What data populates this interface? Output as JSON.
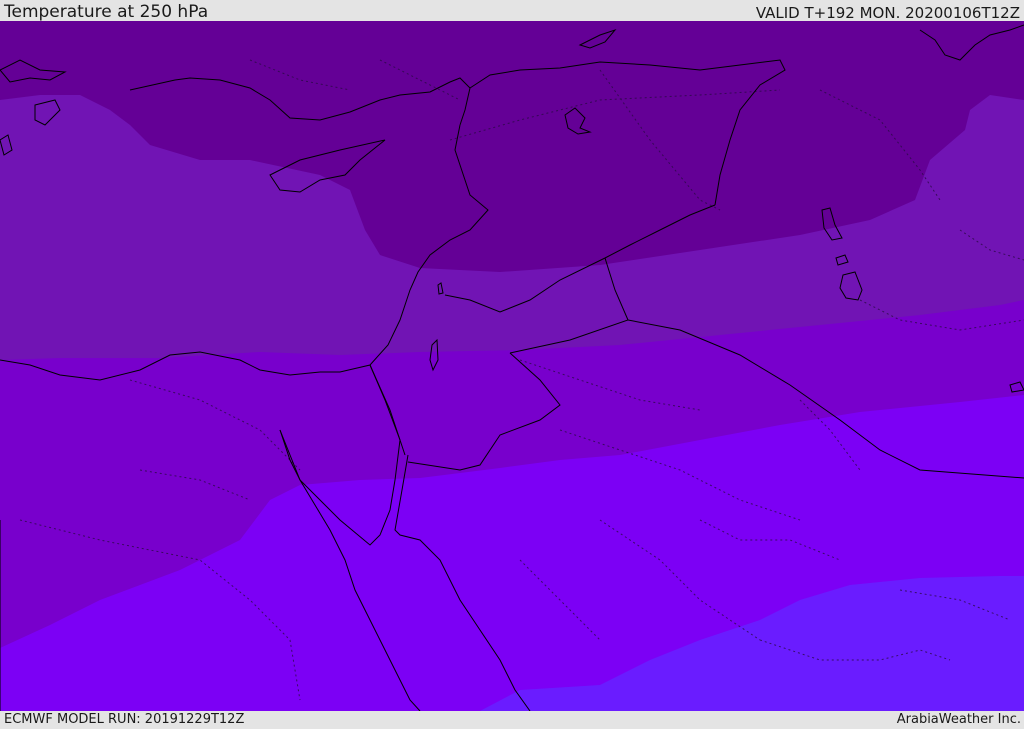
{
  "header": {
    "title": "Temperature at 250 hPa",
    "valid": "VALID T+192 MON. 20200106T12Z"
  },
  "footer": {
    "model_run": "ECMWF MODEL RUN: 20191229T12Z",
    "credit": "ArabiaWeather Inc."
  },
  "map": {
    "field": "temperature-250hPa",
    "colors": {
      "band_1": "#640096",
      "band_2": "#7114b4",
      "band_3": "#7800cc",
      "band_4": "#7c00f5",
      "band_5": "#6a1cff",
      "coastline": "#000000",
      "border": "#333333"
    }
  }
}
